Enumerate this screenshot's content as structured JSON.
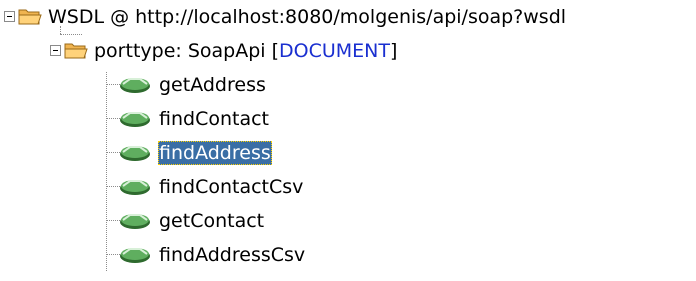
{
  "tree": {
    "root": {
      "label": "WSDL @ http://localhost:8080/molgenis/api/soap?wsdl",
      "icon": "folder-icon",
      "expanded": true
    },
    "porttype": {
      "prefix": "porttype: SoapApi [",
      "style": "DOCUMENT",
      "suffix": "]",
      "icon": "folder-icon",
      "expanded": true
    },
    "operations": [
      {
        "label": "getAddress",
        "icon": "operation-gem-icon",
        "selected": false
      },
      {
        "label": "findContact",
        "icon": "operation-gem-icon",
        "selected": false
      },
      {
        "label": "findAddress",
        "icon": "operation-gem-icon",
        "selected": true
      },
      {
        "label": "findContactCsv",
        "icon": "operation-gem-icon",
        "selected": false
      },
      {
        "label": "getContact",
        "icon": "operation-gem-icon",
        "selected": false
      },
      {
        "label": "findAddressCsv",
        "icon": "operation-gem-icon",
        "selected": false
      }
    ]
  },
  "colors": {
    "selection_bg": "#3a6ea5",
    "keyword": "#1a2fd0",
    "folder": "#f0b450",
    "gem": "#3c8a3c"
  }
}
